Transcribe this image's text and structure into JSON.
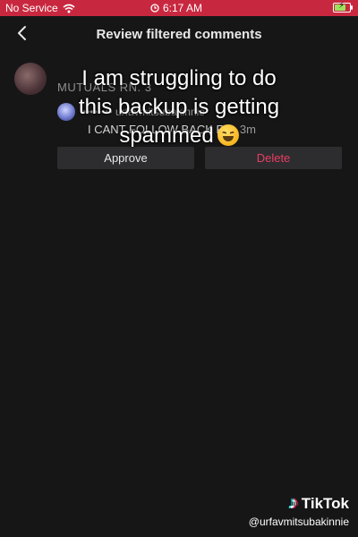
{
  "status_bar": {
    "carrier": "No Service",
    "time": "6:17 AM",
    "battery_level": 0.75
  },
  "header": {
    "title": "Review filtered comments"
  },
  "comment": {
    "text": "MUTUALS RN. 3"
  },
  "reply": {
    "user": "•••••••• urfavmitsubakinnie",
    "text": "I CANT FOLLOW BACK RN",
    "time": "3m"
  },
  "buttons": {
    "approve_label": "Approve",
    "delete_label": "Delete"
  },
  "caption": {
    "line1": "I am struggling to do",
    "line2": "this backup is getting",
    "line3": "spammed"
  },
  "watermark": {
    "brand": "TikTok",
    "username": "@urfavmitsubakinnie"
  },
  "colors": {
    "status_bar": "#c8283f",
    "background": "#161617",
    "delete": "#ea3c62",
    "button_bg": "#2d2d2f"
  },
  "icons": [
    "wifi-icon",
    "alarm-icon",
    "battery-icon",
    "back-arrow-icon",
    "tiktok-logo-icon"
  ]
}
